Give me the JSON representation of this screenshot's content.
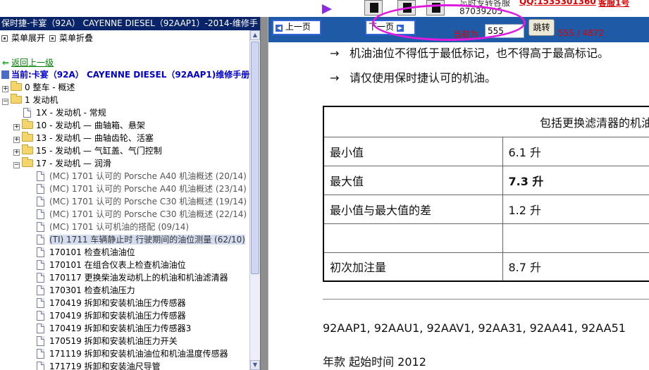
{
  "sidebar": {
    "title": "保时捷-卡宴（92A） CAYENNE DIESEL（92AAP1）-2014-维修手",
    "expand_all": "菜单展开",
    "collapse_all": "菜单折叠",
    "back": "返回上一级",
    "current": "当前:卡宴（92A） CAYENNE DIESEL（92AAP1)维修手册",
    "tree": [
      {
        "toggle": "+",
        "label": "0 整车 - 概述"
      },
      {
        "toggle": "−",
        "label": "1 发动机"
      },
      {
        "label": "1X - 发动机 - 常规"
      },
      {
        "toggle": "+",
        "label": "10 - 发动机 — 曲轴箱、悬架"
      },
      {
        "toggle": "+",
        "label": "13 - 发动机 — 曲轴齿轮、活塞"
      },
      {
        "toggle": "+",
        "label": "15 - 发动机 — 气缸盖、气门控制"
      },
      {
        "toggle": "−",
        "label": "17 - 发动机 — 润滑"
      },
      {
        "label": "(MC) 1701 认可的 Porsche A40 机油概述 (20/14)"
      },
      {
        "label": "(MC) 1701 认可的 Porsche A40 机油概述 (23/14)"
      },
      {
        "label": "(MC) 1701 认可的 Porsche C30 机油概述 (19/14)"
      },
      {
        "label": "(MC) 1701 认可的 Porsche C30 机油概述 (22/14)"
      },
      {
        "label": "(MC) 1701 认可机油的搭配 (09/14)"
      },
      {
        "label": "(TI) 1711 车辆静止时 行驶期间的油位测量 (62/10)"
      },
      {
        "label": "170101 检查机油油位"
      },
      {
        "label": "170101 在组合仪表上检查机油油位"
      },
      {
        "label": "170117 更换柴油发动机上的机油和机油滤清器"
      },
      {
        "label": "170301 检查机油压力"
      },
      {
        "label": "170419 拆卸和安装机油压力传感器"
      },
      {
        "label": "170419 拆卸和安装机油压力传感器"
      },
      {
        "label": "170419 拆卸和安装机油压力传感器3"
      },
      {
        "label": "170519 拆卸和安装机油压力开关"
      },
      {
        "label": "171119 拆卸和安装机油油位和机油温度传感器"
      },
      {
        "label": "171719 拆卸和安装油尺导管"
      }
    ]
  },
  "topstrip": {
    "partial_text": "忘时专转各服",
    "phone": "87039205",
    "qq": "QQ:1535301360",
    "service": "客服1号"
  },
  "nav": {
    "prev": "上一页",
    "next": "下一页",
    "current_label": "当前为",
    "page_value": "555",
    "goto": "跳转",
    "page_count": "555 / 4872"
  },
  "document": {
    "bullets": [
      "机油油位不得低于最低标记，也不得高于最高标记。",
      "请仅使用保时捷认可的机油。"
    ],
    "table": {
      "header": "包括更换滤清器的机油",
      "rows": [
        {
          "label": "最小值",
          "value": "6.1 升",
          "bold": false
        },
        {
          "label": "最大值",
          "value": "7.3 升",
          "bold": true
        },
        {
          "label": "最小值与最大值的差",
          "value": "1.2 升",
          "bold": false
        },
        {
          "label": "",
          "value": "",
          "bold": false
        },
        {
          "label": "初次加注量",
          "value": "8.7 升",
          "bold": false
        }
      ]
    },
    "engine_codes": "92AAP1, 92AAU1, 92AAV1, 92AA31, 92AA41, 92AA51",
    "model_year": "年款 起始时间 2012"
  },
  "colors": {
    "nav_blue": "#1f5aa6",
    "title_bar": "#0a246a",
    "highlight": "#e01ae0",
    "red_text": "#e00000"
  }
}
